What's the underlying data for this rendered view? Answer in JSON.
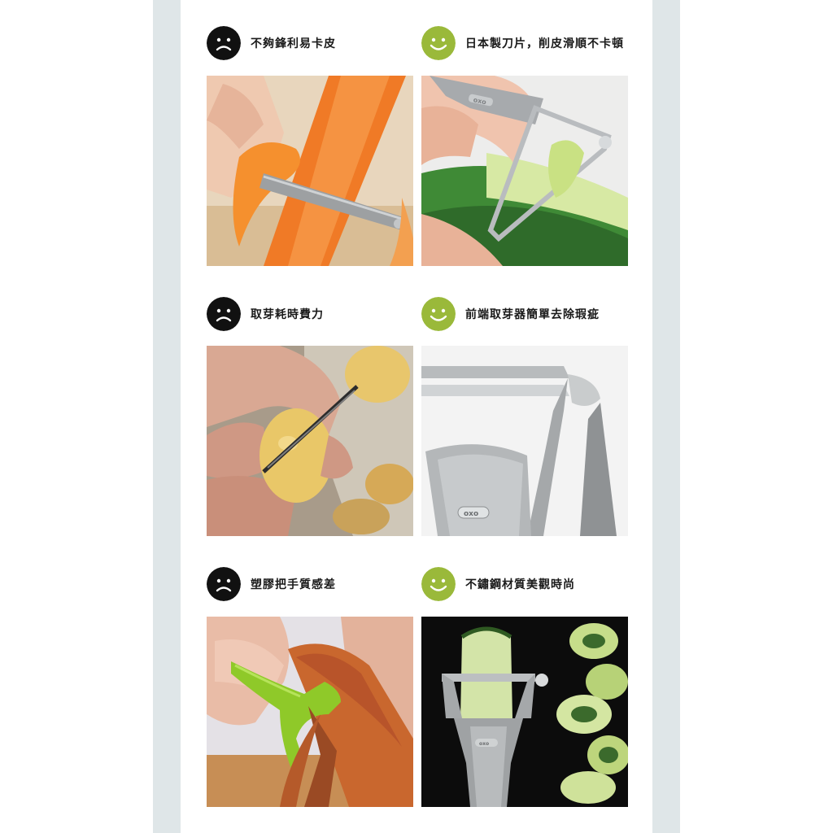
{
  "colors": {
    "sad_face": "#111111",
    "happy_face": "#9ab93a",
    "side_band": "#dfe6e8"
  },
  "rows": [
    {
      "bad": {
        "icon": "sad-face-icon",
        "text": "不夠鋒利易卡皮"
      },
      "good": {
        "icon": "happy-face-icon",
        "text": "日本製刀片，削皮滑順不卡頓"
      }
    },
    {
      "bad": {
        "icon": "sad-face-icon",
        "text": "取芽耗時費力"
      },
      "good": {
        "icon": "happy-face-icon",
        "text": "前端取芽器簡單去除瑕疵"
      }
    },
    {
      "bad": {
        "icon": "sad-face-icon",
        "text": "塑膠把手質感差"
      },
      "good": {
        "icon": "happy-face-icon",
        "text": "不鏽鋼材質美觀時尚"
      }
    }
  ],
  "logo": "oxo"
}
